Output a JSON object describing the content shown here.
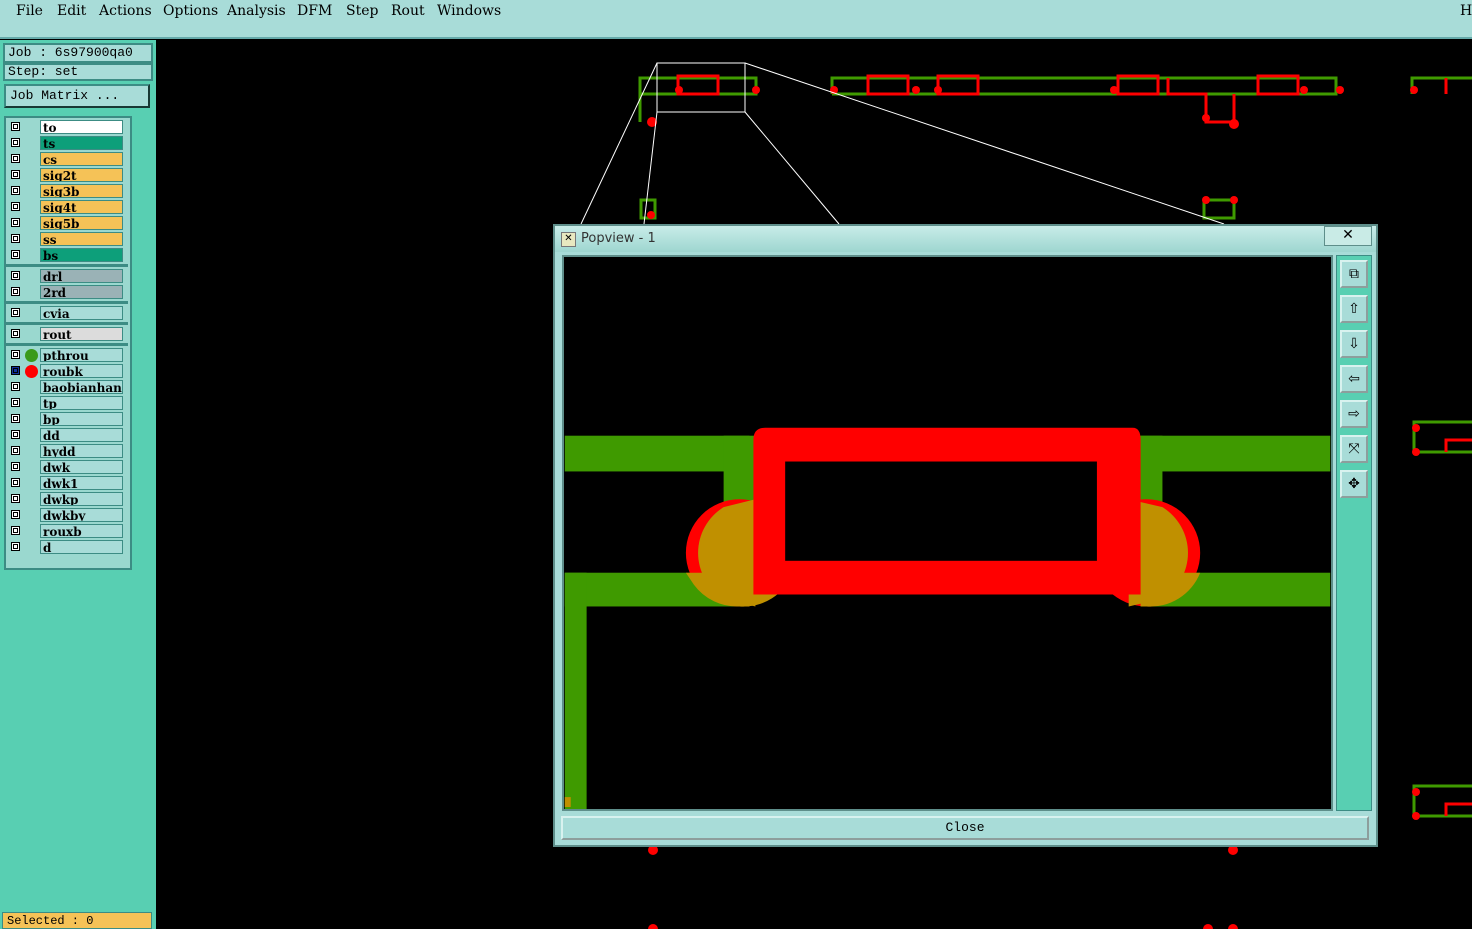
{
  "menubar": {
    "items": [
      "File",
      "Edit",
      "Actions",
      "Options",
      "Analysis",
      "DFM",
      "Step",
      "Rout",
      "Windows"
    ],
    "right_fragment": "H"
  },
  "job": {
    "label": "Job : 6s97900qa0",
    "step": "Step: set",
    "matrix_button": "Job Matrix ..."
  },
  "layers": {
    "board": [
      {
        "name": "to",
        "color": "#ffffff"
      },
      {
        "name": "ts",
        "color": "#0d9f7a"
      },
      {
        "name": "cs",
        "color": "#f5c257"
      },
      {
        "name": "sig2t",
        "color": "#f5c257"
      },
      {
        "name": "sig3b",
        "color": "#f5c257"
      },
      {
        "name": "sig4t",
        "color": "#f5c257"
      },
      {
        "name": "sig5b",
        "color": "#f5c257"
      },
      {
        "name": "ss",
        "color": "#f5c257"
      },
      {
        "name": "bs",
        "color": "#0d9f7a"
      }
    ],
    "drill": [
      {
        "name": "drl",
        "color": "#9ab2b6"
      },
      {
        "name": "2rd",
        "color": "#9ab2b6"
      }
    ],
    "cvia": [
      {
        "name": "cvia",
        "color": "#a8dcd8"
      }
    ],
    "rout": [
      {
        "name": "rout",
        "color": "#dcdcdc"
      }
    ],
    "misc": [
      {
        "name": "pthrou",
        "color": "#a8dcd8",
        "dot": "#3a9a1a"
      },
      {
        "name": "roubk",
        "color": "#a8dcd8",
        "dot": "#ff0000",
        "selected": true
      },
      {
        "name": "baobianhanpa",
        "color": "#a8dcd8"
      },
      {
        "name": "tp",
        "color": "#a8dcd8"
      },
      {
        "name": "bp",
        "color": "#a8dcd8"
      },
      {
        "name": "dd",
        "color": "#a8dcd8"
      },
      {
        "name": "hydd",
        "color": "#a8dcd8"
      },
      {
        "name": "dwk",
        "color": "#a8dcd8"
      },
      {
        "name": "dwk1",
        "color": "#a8dcd8"
      },
      {
        "name": "dwkp",
        "color": "#a8dcd8"
      },
      {
        "name": "dwkby",
        "color": "#a8dcd8"
      },
      {
        "name": "rouxb",
        "color": "#a8dcd8"
      },
      {
        "name": "d",
        "color": "#a8dcd8"
      }
    ]
  },
  "status": {
    "selected": "Selected : 0"
  },
  "popview": {
    "title": "Popview - 1",
    "close_x": "✕",
    "close_button": "Close",
    "tools": [
      "zoom-fit-icon",
      "pan-up-icon",
      "pan-down-icon",
      "pan-left-icon",
      "pan-right-icon",
      "zoom-in-icon",
      "zoom-out-icon"
    ]
  },
  "colors": {
    "trace_green": "#3f9a00",
    "trace_red": "#ff0000",
    "overlap": "#c09000",
    "panel": "#58cfb2",
    "menubar": "#a8dcd8"
  }
}
